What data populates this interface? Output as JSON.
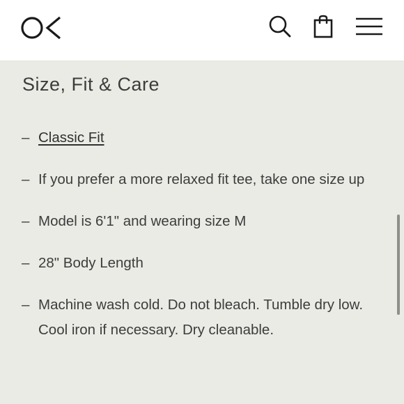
{
  "header": {
    "logo_icon": "ok-logo-icon",
    "search_icon": "search-icon",
    "bag_icon": "shopping-bag-icon",
    "menu_icon": "hamburger-menu-icon",
    "background": "#ffffff"
  },
  "section": {
    "title": "Size, Fit & Care",
    "dash": "–",
    "items": [
      {
        "text": "Classic Fit",
        "link": true
      },
      {
        "text": "If you prefer a more relaxed fit tee, take one size up"
      },
      {
        "text": "Model is 6'1\" and wearing size M"
      },
      {
        "text": "28\" Body Length"
      },
      {
        "text": "Machine wash cold. Do not bleach. Tumble dry low. Cool iron if necessary. Dry cleanable."
      }
    ]
  },
  "colors": {
    "page_background": "#ebebe6",
    "text": "#3c3c3c",
    "icon_stroke": "#1a1a1a"
  }
}
